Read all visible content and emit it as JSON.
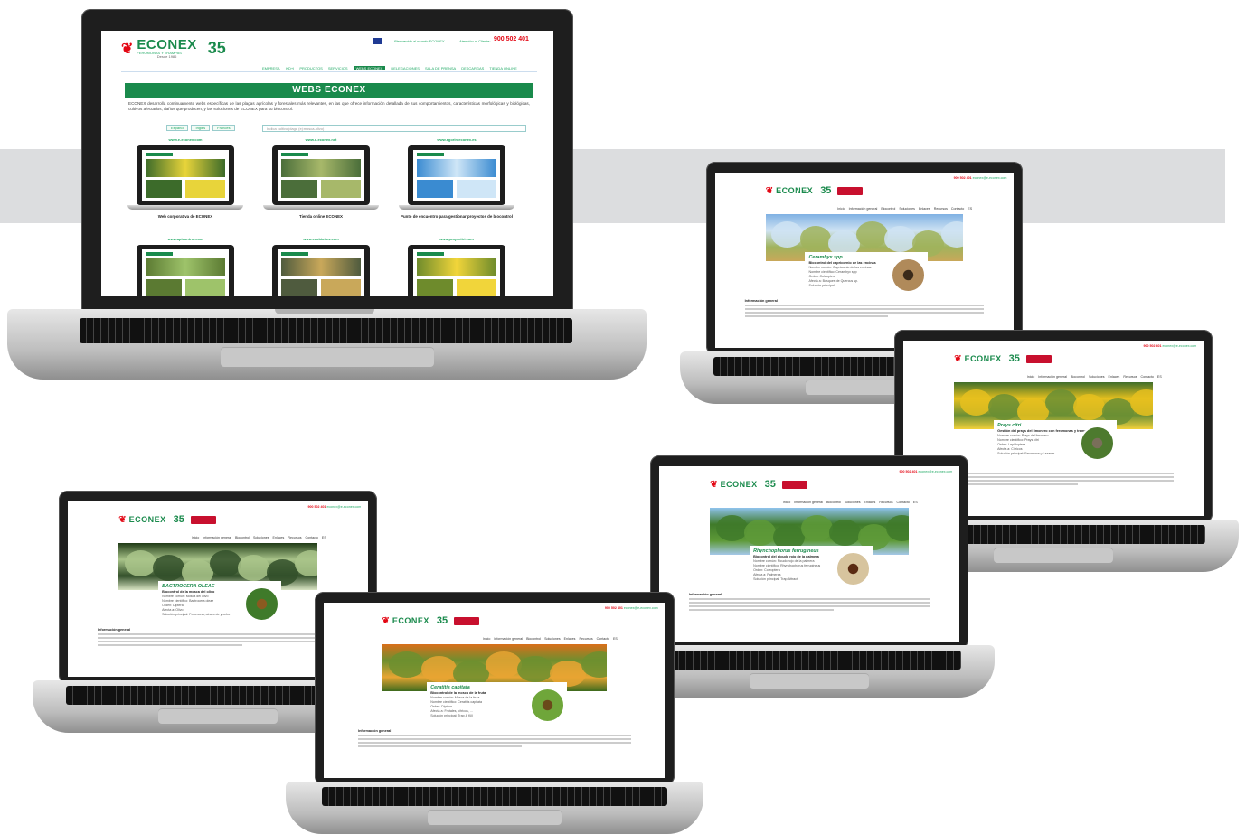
{
  "main": {
    "brand": "ECONEX",
    "tagline": "FEROMONAS Y TRAMPAS",
    "since": "Desde 1986",
    "anniversary": "35",
    "welcome": "Bienvenido al mundo ECONEX",
    "phone_label": "Atención al Cliente:",
    "phone": "900 502 401",
    "nav": [
      "EMPRESA",
      "I+D+i",
      "PRODUCTOS",
      "SERVICIOS",
      "WEBS ECONEX",
      "DELEGACIONES",
      "SALA DE PRENSA",
      "DESCARGAS",
      "TIENDA ONLINE"
    ],
    "nav_active": "WEBS ECONEX",
    "banner_title": "WEBS ECONEX",
    "intro": "ECONEX desarrolla continuamente webs específicas de las plagas agrícolas y forestales más relevantes, en las que ofrece información detallada de sus comportamientos, características morfológicas y biológicas, cultivos afectados, daños que producen, y las soluciones de ECONEX para su biocontrol.",
    "lang_buttons": [
      "Español",
      "Inglés",
      "Francés"
    ],
    "search_placeholder": "Indica cultivo/plaga (ej:mosca-olivo)",
    "cards": [
      {
        "url": "www.e-econex.com",
        "caption": "Web corporativa de ECONEX"
      },
      {
        "url": "www.e-econex.net",
        "caption": "Tienda online ECONEX"
      },
      {
        "url": "www.agorin-econex.es",
        "caption": "Punto de encuentro para gestionar proyectos de biocontrol"
      },
      {
        "url": "www.apicontrol.com",
        "caption": ""
      },
      {
        "url": "www.ecobiotics.com",
        "caption": ""
      },
      {
        "url": "www.prayscitri.com",
        "caption": ""
      }
    ]
  },
  "topbar": {
    "phone": "900 502 401",
    "email": "econex@e-econex.com"
  },
  "species_nav": [
    "Inicio",
    "Información general",
    "Biocontrol",
    "Soluciones",
    "Enlaces",
    "Recursos",
    "Contacto",
    "ES"
  ],
  "pages": [
    {
      "title": "Cerambyx spp",
      "subtitle": "Biocontrol del capricornio de las encinas",
      "lines": [
        "Nombre común: Capricornio de las encinas",
        "Nombre científico: Cerambyx spp",
        "Orden: Coleoptera",
        "Afecta a: Bosques de Quercus sp.",
        "Solución principal: ..."
      ],
      "section": "Información general"
    },
    {
      "title": "Prays citri",
      "subtitle": "Gestión del prays del limonero con feromonas y trampas",
      "lines": [
        "Nombre común: Prays del limonero",
        "Nombre científico: Prays citri",
        "Orden: Lepidoptera",
        "Afecta a: Cítricos",
        "Solución principal: Feromona y Lazarus"
      ],
      "section": "Información general"
    },
    {
      "title": "BACTROCERA OLEAE",
      "subtitle": "Biocontrol de la mosca del olivo",
      "lines": [
        "Nombre común: Mosca del olivo",
        "Nombre científico: Bactrocera oleae",
        "Orden: Diptera",
        "Afecta a: Olivo",
        "Solución principal: Feromona, atrayente y cebo"
      ],
      "section": "Información general"
    },
    {
      "title": "Rhynchophorus ferrugineus",
      "subtitle": "Biocontrol del picudo rojo de la palmera",
      "lines": [
        "Nombre común: Picudo rojo de la palmera",
        "Nombre científico: Rhynchophorus ferrugineus",
        "Orden: Coleoptera",
        "Afecta a: Palmeras",
        "Solución principal: Trap-Attract"
      ],
      "section": "Información general"
    },
    {
      "title": "Ceratitis capitata",
      "subtitle": "Biocontrol de la mosca de la fruta",
      "lines": [
        "Nombre común: Mosca de la fruta",
        "Nombre científico: Ceratitis capitata",
        "Orden: Diptera",
        "Afecta a: Frutales, cítricos, ...",
        "Solución principal: Trap & Kill"
      ],
      "section": "Información general"
    }
  ],
  "colors": {
    "green": "#1a8a4c",
    "red": "#e30613",
    "band": "#dcdddf"
  }
}
